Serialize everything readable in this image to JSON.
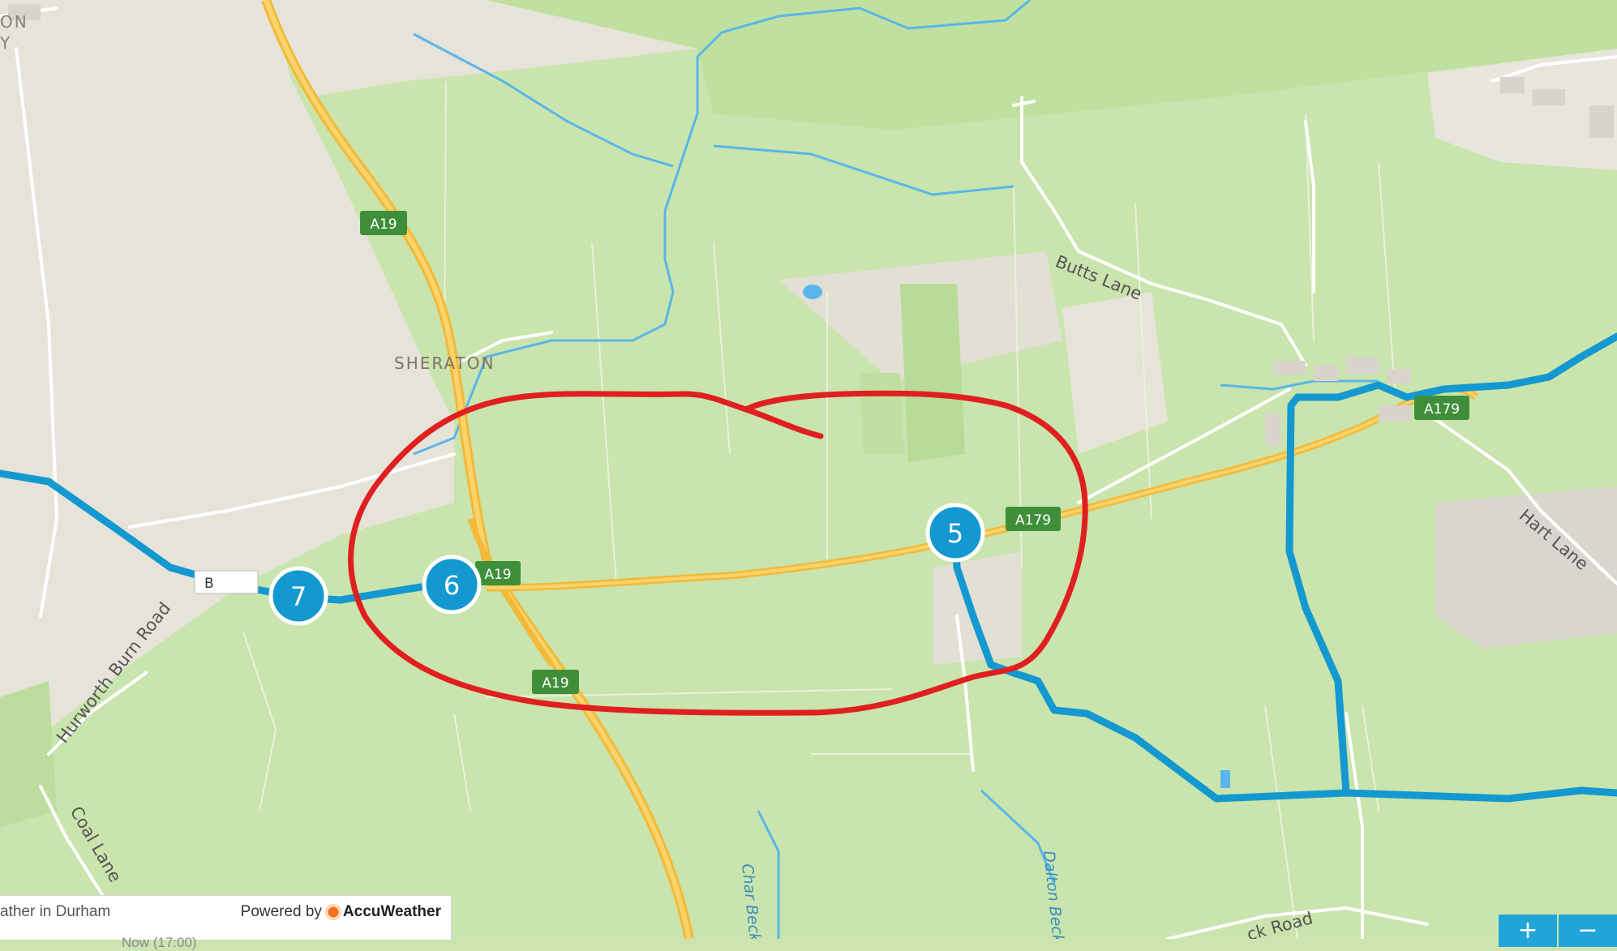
{
  "colors": {
    "woodland": "#c6e3a8",
    "farmland": "#e8e4d8",
    "water": "#5ab6ea",
    "major_road": "#f6c24a",
    "route": "#1498d0",
    "road_badge": "#3f8f3a",
    "annotation": "#e02020"
  },
  "place_labels": {
    "top_left_1": "ON",
    "top_left_2": "Y",
    "sheraton": "SHERATON"
  },
  "road_labels": {
    "a19_north": "A19",
    "a19_mid": "A19",
    "a19_south": "A19",
    "a179_mid": "A179",
    "a179_east": "A179",
    "butts_lane": "Butts Lane",
    "hart_lane": "Hart Lane",
    "hurworth_burn_road": "Hurworth Burn Road",
    "coal_lane": "Coal Lane",
    "char_beck": "Char Beck",
    "dalton_beck": "Dalton Beck",
    "bottom_road": "ck Road",
    "route_label_obscured": "B"
  },
  "route_stops": [
    {
      "label": "5"
    },
    {
      "label": "6"
    },
    {
      "label": "7"
    }
  ],
  "weather": {
    "title": "ather in Durham",
    "powered_by": "Powered by",
    "brand": "AccuWeather",
    "now": "Now (17:00)"
  },
  "zoom": {
    "zoom_in": "+",
    "zoom_out": "−"
  }
}
